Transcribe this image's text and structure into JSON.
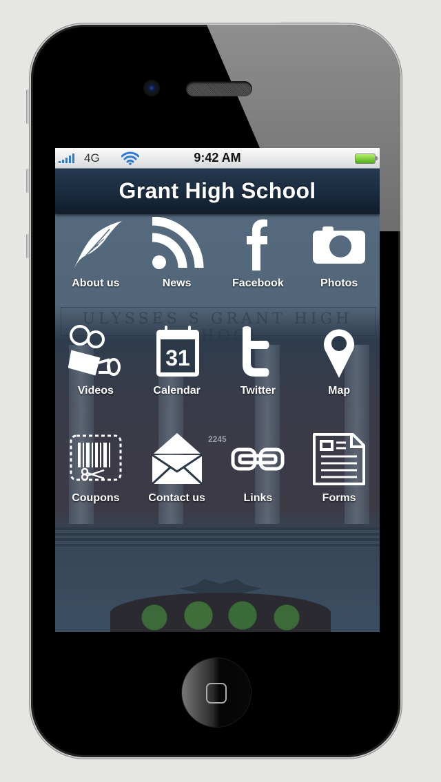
{
  "status_bar": {
    "carrier": "4G",
    "time": "9:42 AM",
    "signal_bars": 5,
    "wifi_icon": "wifi-icon",
    "battery_level": 1.0
  },
  "nav": {
    "title": "Grant High School"
  },
  "background": {
    "inscription": "ULYSSES S GRANT HIGH SCHOOL",
    "building_number": "2245"
  },
  "tiles": [
    {
      "label": "About us",
      "icon": "feather-icon"
    },
    {
      "label": "News",
      "icon": "rss-icon"
    },
    {
      "label": "Facebook",
      "icon": "facebook-icon"
    },
    {
      "label": "Photos",
      "icon": "camera-icon"
    },
    {
      "label": "Videos",
      "icon": "video-camera-icon"
    },
    {
      "label": "Calendar",
      "icon": "calendar-icon",
      "icon_text": "31"
    },
    {
      "label": "Twitter",
      "icon": "twitter-icon"
    },
    {
      "label": "Map",
      "icon": "map-pin-icon"
    },
    {
      "label": "Coupons",
      "icon": "coupon-icon"
    },
    {
      "label": "Contact us",
      "icon": "envelope-icon"
    },
    {
      "label": "Links",
      "icon": "link-icon"
    },
    {
      "label": "Forms",
      "icon": "form-icon"
    }
  ],
  "colors": {
    "nav_bar": "#1a2c40",
    "label_text": "#ffffff",
    "signal": "#2d7ad6",
    "battery": "#4fae18"
  }
}
